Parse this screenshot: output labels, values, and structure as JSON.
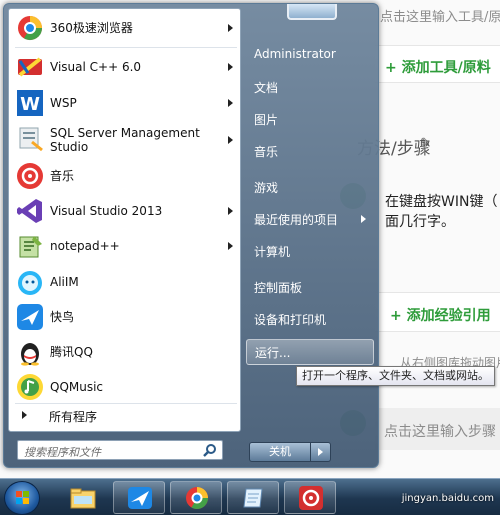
{
  "background": {
    "top_hint": "点击这里输入工具/原料",
    "add_tools": "+ 添加工具/原料",
    "method_heading": "方法/步骤",
    "step_line1": "在键盘按WIN键（",
    "step_line2": "面几行字。",
    "add_experience": "+ 添加经验引用",
    "drag_hint": "从右侧图库拖动图片",
    "bottom_hint": "点击这里输入步骤"
  },
  "start_menu": {
    "programs": [
      {
        "label": "360极速浏览器",
        "icon": "chrome-360-icon",
        "has_arrow": true
      },
      {
        "label": "Visual C++ 6.0",
        "icon": "visual-cpp-icon",
        "has_arrow": true
      },
      {
        "label": "WSP",
        "icon": "wsp-icon",
        "has_arrow": true
      },
      {
        "label_line1": "SQL Server Management",
        "label_line2": "Studio",
        "icon": "sql-server-icon",
        "has_arrow": true
      },
      {
        "label": "音乐",
        "icon": "music-icon",
        "has_arrow": false
      },
      {
        "label": "Visual Studio 2013",
        "icon": "visual-studio-icon",
        "has_arrow": true
      },
      {
        "label": "notepad++",
        "icon": "notepad-plus-icon",
        "has_arrow": true
      },
      {
        "label": "AliIM",
        "icon": "aliim-icon",
        "has_arrow": false
      },
      {
        "label": "快鸟",
        "icon": "kuainiao-icon",
        "has_arrow": false
      },
      {
        "label": "腾讯QQ",
        "icon": "qq-penguin-icon",
        "has_arrow": false
      },
      {
        "label": "QQMusic",
        "icon": "qqmusic-icon",
        "has_arrow": false
      }
    ],
    "all_programs": "所有程序",
    "search_placeholder": "搜索程序和文件",
    "right_items": [
      {
        "label": "Administrator",
        "has_arrow": false
      },
      {
        "label": "文档",
        "has_arrow": false
      },
      {
        "label": "图片",
        "has_arrow": false
      },
      {
        "label": "音乐",
        "has_arrow": false
      },
      {
        "label": "游戏",
        "has_arrow": false
      },
      {
        "label": "最近使用的项目",
        "has_arrow": true
      },
      {
        "label": "计算机",
        "has_arrow": false
      },
      {
        "label": "控制面板",
        "has_arrow": false
      },
      {
        "label": "设备和打印机",
        "has_arrow": false
      },
      {
        "label": "运行...",
        "has_arrow": false,
        "highlighted": true
      }
    ],
    "shutdown_label": "关机",
    "tooltip": "打开一个程序、文件夹、文档或网站。"
  },
  "taskbar": {
    "pinned": [
      "explorer-folder-icon",
      "kuainiao-icon",
      "chrome-360-icon",
      "notepad-icon",
      "netease-music-icon"
    ],
    "watermark": "jingyan.baidu.com"
  }
}
